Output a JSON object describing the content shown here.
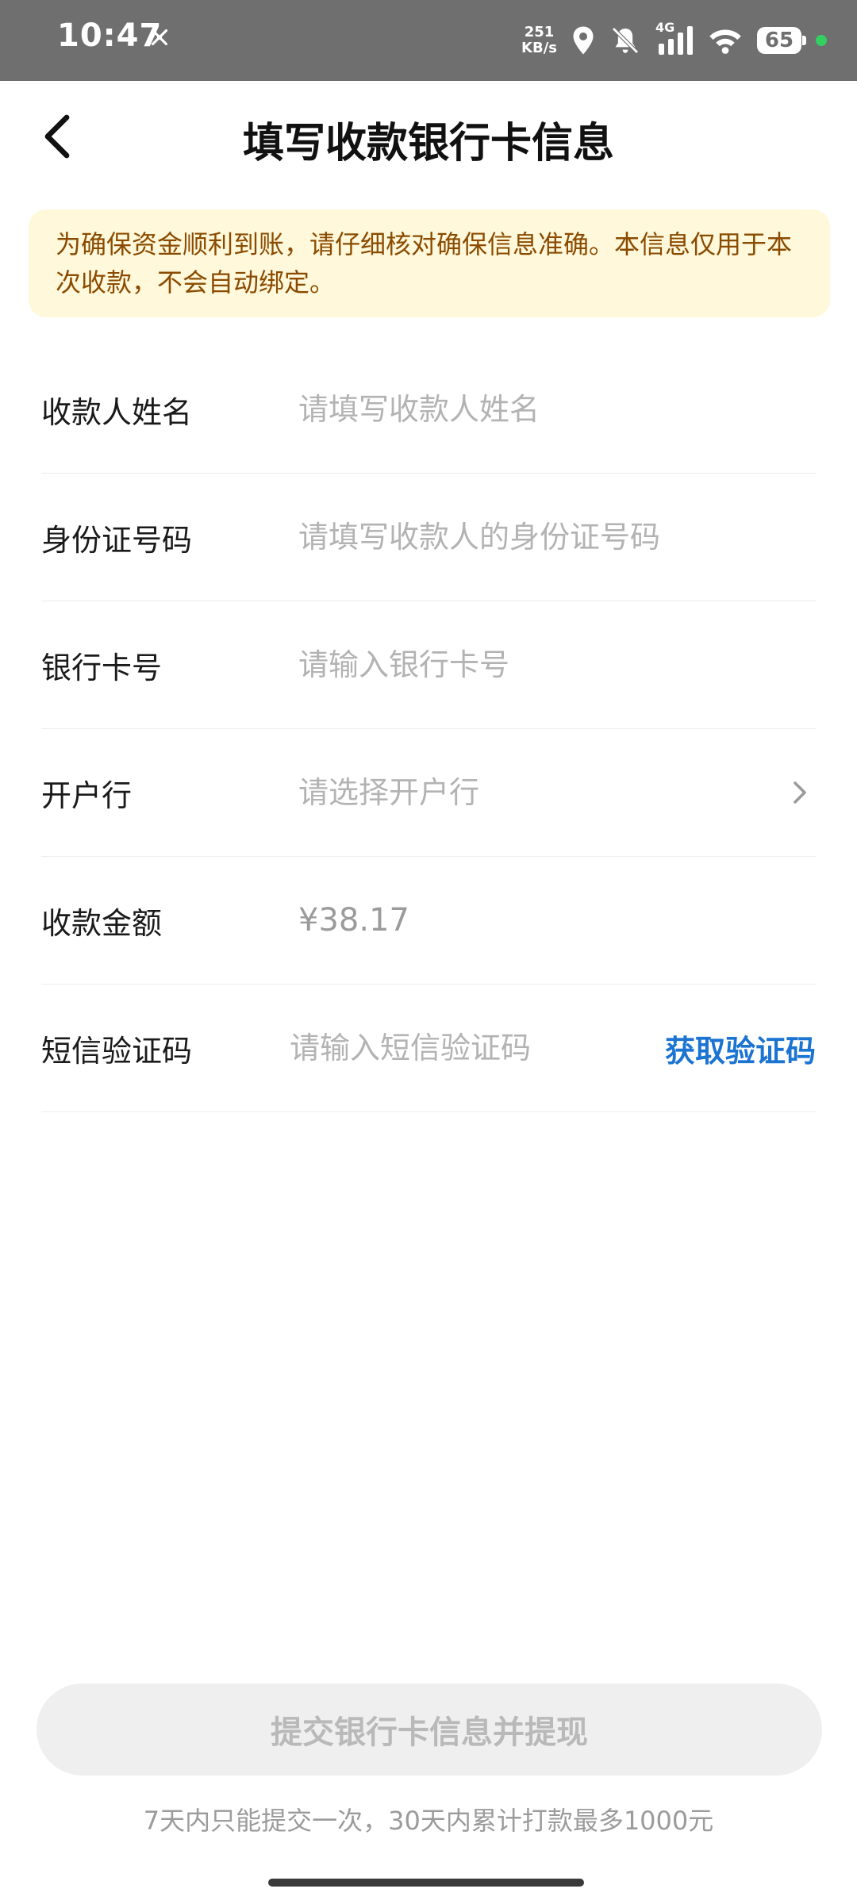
{
  "status_bar": {
    "time": "10:47",
    "net_speed_value": "251",
    "net_speed_unit": "KB/s",
    "network": "4G",
    "battery": "65"
  },
  "header": {
    "title": "填写收款银行卡信息"
  },
  "notice": {
    "text": "为确保资金顺利到账，请仔细核对确保信息准确。本信息仅用于本次收款，不会自动绑定。"
  },
  "form": {
    "name": {
      "label": "收款人姓名",
      "placeholder": "请填写收款人姓名"
    },
    "id_number": {
      "label": "身份证号码",
      "placeholder": "请填写收款人的身份证号码"
    },
    "card_number": {
      "label": "银行卡号",
      "placeholder": "请输入银行卡号"
    },
    "bank": {
      "label": "开户行",
      "placeholder": "请选择开户行"
    },
    "amount": {
      "label": "收款金额",
      "value": "¥38.17"
    },
    "sms": {
      "label": "短信验证码",
      "placeholder": "请输入短信验证码",
      "action": "获取验证码"
    }
  },
  "submit": {
    "label": "提交银行卡信息并提现"
  },
  "footnote": "7天内只能提交一次，30天内累计打款最多1000元",
  "colors": {
    "accent": "#1b73d2",
    "notice_bg": "#fff8db",
    "notice_text": "#8a4b00"
  }
}
